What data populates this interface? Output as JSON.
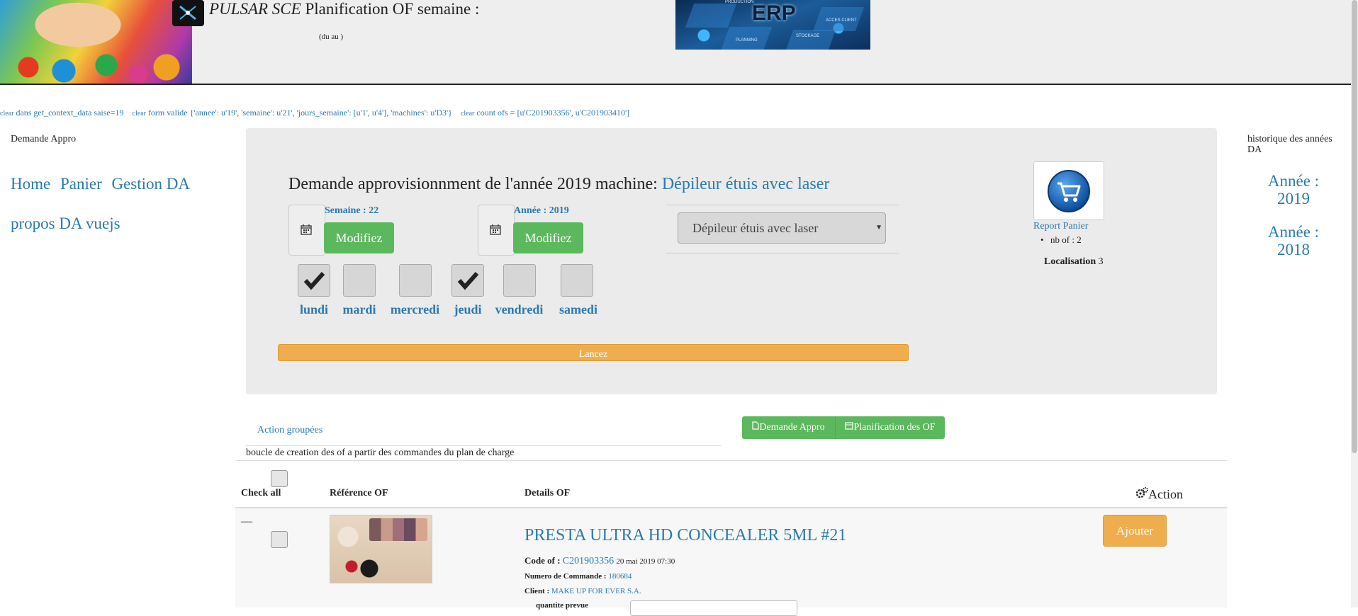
{
  "header": {
    "title_brand": "PULSAR SCE",
    "title_rest": "Planification OF semaine :",
    "date_range": "(du au )",
    "banner_text": "ERP",
    "banner_tags": [
      "PRODUCTION",
      "ACCES CLIENT",
      "STOCKAGE",
      "PLANNING"
    ]
  },
  "debug": {
    "items": [
      {
        "tag": "clear",
        "text": "dans get_context_data saise=19"
      },
      {
        "tag": "clear",
        "text": "form valide {'annee': u'19', 'semaine': u'21', 'jours_semaine': [u'1', u'4'], 'machines': u'D3'}"
      },
      {
        "tag": "clear",
        "text": "count ofs = [u'C201903356', u'C201903410']"
      }
    ]
  },
  "sidebar": {
    "title": "Demande Appro",
    "items": [
      "Home",
      "Panier",
      "Gestion DA",
      "propos DA vuejs"
    ]
  },
  "history": {
    "title": "historique des années DA",
    "years": [
      "Année : 2019",
      "Année : 2018"
    ]
  },
  "panel": {
    "heading_prefix": "Demande approvisionnment de l'année 2019 machine:",
    "heading_machine": "Dépileur étuis avec laser",
    "week_label": "Semaine : 22",
    "year_label": "Année : 2019",
    "modify_label": "Modifiez",
    "machine_selected": "Dépileur étuis avec laser",
    "days": [
      {
        "label": "lundi",
        "checked": true
      },
      {
        "label": "mardi",
        "checked": false
      },
      {
        "label": "mercredi",
        "checked": false
      },
      {
        "label": "jeudi",
        "checked": true
      },
      {
        "label": "vendredi",
        "checked": false
      },
      {
        "label": "samedi",
        "checked": false
      }
    ],
    "launch_label": "Lancez"
  },
  "cart": {
    "link": "Report Panier",
    "count": "nb of : 2",
    "localisation_label": "Localisation",
    "localisation_value": "3"
  },
  "actions": {
    "group_action": "Action groupées",
    "btn_demande": "Demande Appro",
    "btn_planif": "Planification des OF",
    "loop_note": "boucle de creation des of a partir des commandes du plan de charge"
  },
  "table": {
    "headers": {
      "check": "Check all",
      "ref": "Référence OF",
      "details": "Details OF",
      "action": "Action"
    },
    "row": {
      "dash": "—",
      "product": "PRESTA ULTRA HD CONCEALER 5ML #21",
      "code_label": "Code of :",
      "code": "C201903356",
      "date": "20 mai 2019 07:30",
      "order_label": "Numero de Commande :",
      "order": "180684",
      "client_label": "Client :",
      "client": "MAKE UP FOR EVER S.A.",
      "qty_label": "quantite prevue",
      "add_label": "Ajouter"
    }
  },
  "colors": {
    "link": "#2a7ab0",
    "green": "#5cb85c",
    "orange": "#f0ad4e",
    "panel": "#ebebeb"
  }
}
